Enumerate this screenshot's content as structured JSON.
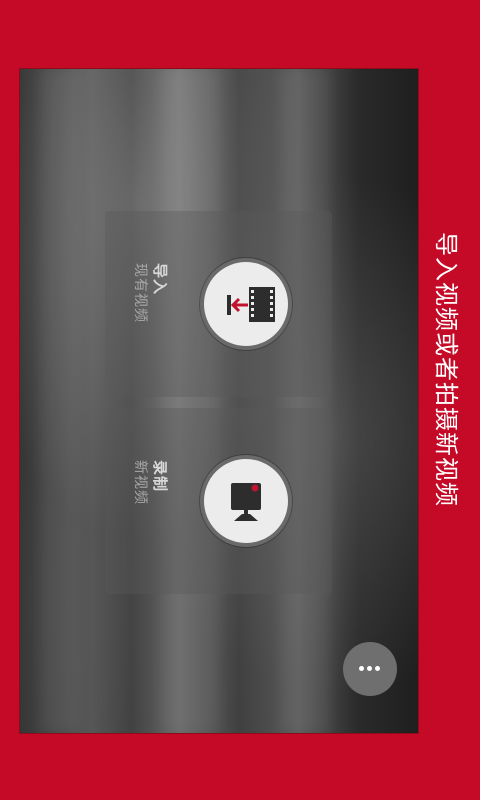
{
  "side_title": "导入视频或者拍摄新视频",
  "import_card": {
    "label": "导入",
    "sublabel": "现有视频",
    "icon": "import-film-icon"
  },
  "record_card": {
    "label": "录制",
    "sublabel": "新视频",
    "icon": "video-camera-icon"
  },
  "more_button": {
    "icon": "more-dots-icon"
  },
  "colors": {
    "frame_red": "#c40a26",
    "icon_red": "#c0142e",
    "icon_dark": "#2d2d2d",
    "circle_fill": "#ececec"
  }
}
